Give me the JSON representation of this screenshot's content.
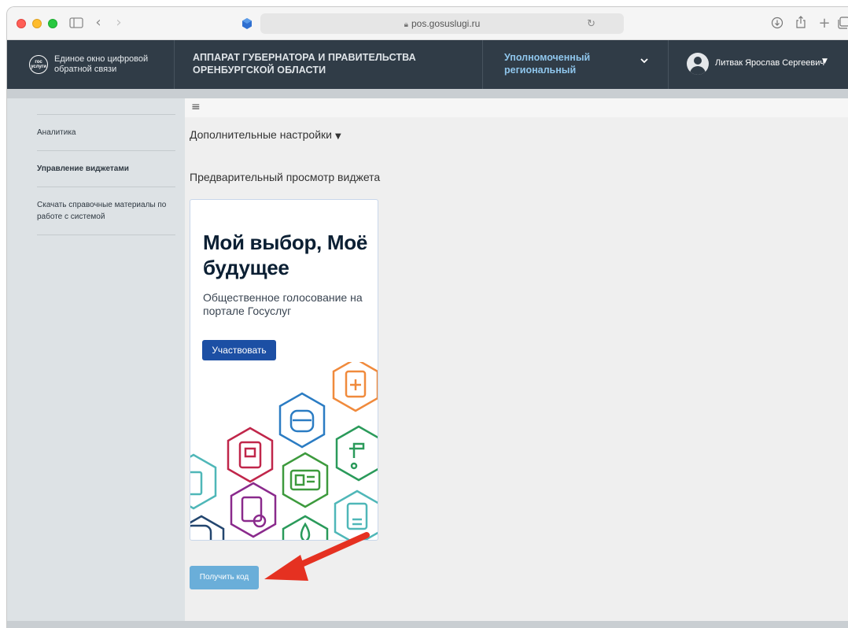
{
  "browser": {
    "url": "pos.gosuslugi.ru",
    "icons": {
      "sidebar": "sidebar-icon",
      "back": "back-icon",
      "forward": "forward-icon",
      "reload": "reload-icon",
      "download": "download-icon",
      "share": "share-icon",
      "new_tab": "plus-icon",
      "tabs": "tabs-icon"
    }
  },
  "header": {
    "logo_badge_line1": "гос",
    "logo_badge_line2": "услуги",
    "logo_text": "Единое окно цифровой обратной связи",
    "org_title": "АППАРАТ ГУБЕРНАТОРА И ПРАВИТЕЛЬСТВА ОРЕНБУРГСКОЙ ОБЛАСТИ",
    "role": "Уполномоченный региональный",
    "user_name": "Литвак Ярослав Сергеевич"
  },
  "sidebar": {
    "items": [
      {
        "label": "Аналитика",
        "active": false
      },
      {
        "label": "Управление виджетами",
        "active": true
      },
      {
        "label": "Скачать справочные материалы по работе с системой",
        "active": false
      }
    ]
  },
  "main": {
    "advanced_settings": "Дополнительные настройки",
    "preview_title": "Предварительный просмотр виджета",
    "widget": {
      "headline": "Мой выбор, Моё будущее",
      "subtitle": "Общественное голосование на портале Госуслуг",
      "button_label": "Участвовать"
    },
    "get_code_label": "Получить код"
  },
  "colors": {
    "header_bg": "#303c47",
    "role_accent": "#8fc6ec",
    "widget_button": "#1c4fa4",
    "get_code_button": "#6aaed9",
    "annotation_arrow": "#e53121"
  }
}
